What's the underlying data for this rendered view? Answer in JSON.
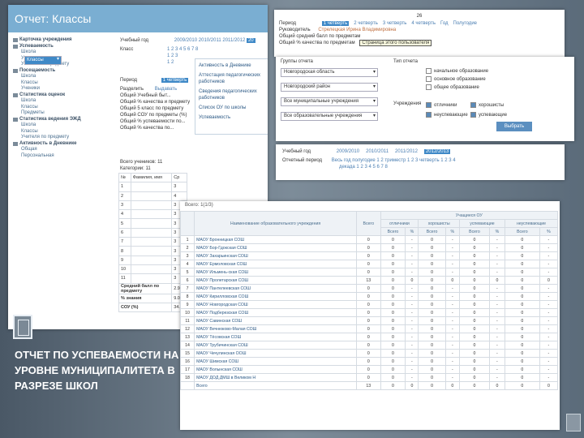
{
  "slide": {
    "caption": "ОТЧЕТ ПО УСПЕВАЕМОСТИ НА УРОВНЕ МУНИЦИПАЛИТЕТА В РАЗРЕЗЕ ШКОЛ"
  },
  "shot1": {
    "title": "Отчет: Классы",
    "sidebar": [
      {
        "type": "g",
        "label": "Карточка учреждения"
      },
      {
        "type": "g",
        "label": "Успеваемость"
      },
      {
        "type": "i",
        "label": "Школа"
      },
      {
        "type": "i",
        "label": "Классы",
        "selected": true
      },
      {
        "type": "i",
        "label": "Ученики"
      },
      {
        "type": "i",
        "label": "Ученики по предмету"
      },
      {
        "type": "g",
        "label": "Посещаемость"
      },
      {
        "type": "i",
        "label": "Школа"
      },
      {
        "type": "i",
        "label": "Классы"
      },
      {
        "type": "i",
        "label": "Ученики"
      },
      {
        "type": "g",
        "label": "Статистика оценок"
      },
      {
        "type": "i",
        "label": "Школа"
      },
      {
        "type": "i",
        "label": "Классы"
      },
      {
        "type": "i",
        "label": "Предметы"
      },
      {
        "type": "g",
        "label": "Статистика ведения ЭЖД"
      },
      {
        "type": "i",
        "label": "Школа"
      },
      {
        "type": "i",
        "label": "Классы"
      },
      {
        "type": "i",
        "label": "Учителя по предмету"
      },
      {
        "type": "g",
        "label": "Активность в Дневнике"
      },
      {
        "type": "i",
        "label": "Общая"
      },
      {
        "type": "i",
        "label": "Персональная"
      }
    ],
    "years_label": "Учебный год",
    "years": [
      "2009/2010",
      "2010/2011",
      "2011/2012",
      "20"
    ],
    "class_label": "Класс",
    "class_nums": "1 2 3 4 5 6 7 8",
    "class_nums2": "1 2 3",
    "class_nums3": "1 2",
    "period_label": "Период",
    "period_value": "1 четверть",
    "razdel_label": "Разделить",
    "razdel_value": "Выдавать",
    "rows": [
      "Общий Учебный быт...",
      "Общий % качества и предмету",
      "Общий 5 класс по предмету",
      "Общий СОУ по предметы (%)",
      "Общий % успеваемости по...",
      "Общий % качества по..."
    ],
    "popup": [
      "Активность в Дневнике",
      "Аттестация педагогических работников",
      "Сведения педагогических работников",
      "Список ОУ по школы",
      "Успеваемость"
    ],
    "count_note": "Всего учеников: 11",
    "count_note2": "Категории: 11",
    "tbl_headers": [
      "№",
      "Фамилия, имя",
      "Ср"
    ],
    "tbl_rows": [
      [
        "1",
        "",
        "3"
      ],
      [
        "2",
        "",
        "4"
      ],
      [
        "3",
        "",
        "3"
      ],
      [
        "4",
        "",
        "3"
      ],
      [
        "5",
        "",
        "3"
      ],
      [
        "6",
        "",
        "3"
      ],
      [
        "7",
        "",
        "3"
      ],
      [
        "8",
        "",
        "3"
      ],
      [
        "9",
        "",
        "3"
      ],
      [
        "10",
        "",
        "3"
      ],
      [
        "11",
        "",
        "3"
      ]
    ],
    "tbl_foot": [
      [
        "Средний балл по предмету",
        "2.91"
      ],
      [
        "% знания",
        "9.09"
      ],
      [
        "СОУ (%)",
        "34.91"
      ]
    ]
  },
  "shot2": {
    "top_num": "26",
    "period_label": "Период",
    "periods": [
      "1 четверть",
      "2 четверть",
      "3 четверть",
      "4 четверть",
      "Год",
      "Полугодие"
    ],
    "lbl1": "Руководитель",
    "val1": "Стрелецкая Ирина Владимировна",
    "line1": "Общий средний балл по предметам",
    "line2": "Общий % качества по предметам",
    "tip": "Страница этого пользователя"
  },
  "shot3": {
    "rows_label": "Группы отчета",
    "selects": [
      "Новгородская область",
      "Новгородский район",
      "Все муниципальные учреждения",
      "Все образовательные учреждения"
    ],
    "type_label": "Тип отчета",
    "org_label": "Учреждения",
    "checks": [
      {
        "label": "начальное образование",
        "on": false
      },
      {
        "label": "основное образование",
        "on": false
      },
      {
        "label": "общее образование",
        "on": false
      },
      {
        "label": "отличники",
        "on": true
      },
      {
        "label": "хорошисты",
        "on": true
      },
      {
        "label": "неуспевающие",
        "on": true
      },
      {
        "label": "успевающие",
        "on": true
      }
    ],
    "button": "Выбрать"
  },
  "shot4": {
    "year_label": "Учебный год",
    "years": [
      "2009/2010",
      "2010/2011",
      "2011/2012",
      "2012/2013"
    ],
    "period_label": "Отчетный период",
    "period_row1": "Весь год   полугодие  1   2   триместр  1   2   3   четверть  1   2   3   4",
    "period_row2": "декада  1   2   3   4   5   6   7   8"
  },
  "shot5": {
    "title": "Всего: 1(1/3)",
    "col_name": "Наименование образовательного учреждения",
    "col_total": "Всего",
    "col_group": "Учащиеся ОУ",
    "sub": [
      "отличники",
      "хорошисты",
      "успевающие",
      "неуспевающие"
    ],
    "sub2": [
      "Всего",
      "%",
      "Всего",
      "%",
      "Всего",
      "%",
      "Всего",
      "%"
    ],
    "rows": [
      [
        "1",
        "МАОУ Бронницкая СОШ",
        "0",
        "0",
        "-",
        "0",
        "-",
        "0",
        "-",
        "0",
        "-"
      ],
      [
        "2",
        "МАОУ Бор-Гдокская СОШ",
        "0",
        "0",
        "-",
        "0",
        "-",
        "0",
        "-",
        "0",
        "-"
      ],
      [
        "3",
        "МАОУ Захарьинская СОШ",
        "0",
        "0",
        "-",
        "0",
        "-",
        "0",
        "-",
        "0",
        "-"
      ],
      [
        "4",
        "МАОУ Ермоловская СОШ",
        "0",
        "0",
        "-",
        "0",
        "-",
        "0",
        "-",
        "0",
        "-"
      ],
      [
        "5",
        "МАОУ Ильмень-ская СОШ",
        "0",
        "0",
        "-",
        "0",
        "-",
        "0",
        "-",
        "0",
        "-"
      ],
      [
        "6",
        "МАОУ Пролетарская СОШ",
        "13",
        "0",
        "0",
        "0",
        "0",
        "0",
        "0",
        "0",
        "0"
      ],
      [
        "7",
        "МАОУ Пантелеевская СОШ",
        "0",
        "0",
        "-",
        "0",
        "-",
        "0",
        "-",
        "0",
        "-"
      ],
      [
        "8",
        "МАОУ Кирилловская СОШ",
        "0",
        "0",
        "-",
        "0",
        "-",
        "0",
        "-",
        "0",
        "-"
      ],
      [
        "9",
        "МАОУ Новгородская СОШ",
        "0",
        "0",
        "-",
        "0",
        "-",
        "0",
        "-",
        "0",
        "-"
      ],
      [
        "10",
        "МАОУ Подберезская СОШ",
        "0",
        "0",
        "-",
        "0",
        "-",
        "0",
        "-",
        "0",
        "-"
      ],
      [
        "11",
        "МАОУ Савинская СОШ",
        "0",
        "0",
        "-",
        "0",
        "-",
        "0",
        "-",
        "0",
        "-"
      ],
      [
        "12",
        "МАОУ Вечнюково-Малая СОШ",
        "0",
        "0",
        "-",
        "0",
        "-",
        "0",
        "-",
        "0",
        "-"
      ],
      [
        "13",
        "МАОУ Тёсовская СОШ",
        "0",
        "0",
        "-",
        "0",
        "-",
        "0",
        "-",
        "0",
        "-"
      ],
      [
        "14",
        "МАОУ Трубичинская СОШ",
        "0",
        "0",
        "-",
        "0",
        "-",
        "0",
        "-",
        "0",
        "-"
      ],
      [
        "15",
        "МАОУ Чечулинская ООШ",
        "0",
        "0",
        "-",
        "0",
        "-",
        "0",
        "-",
        "0",
        "-"
      ],
      [
        "16",
        "МАОУ Шимская СОШ",
        "0",
        "0",
        "-",
        "0",
        "-",
        "0",
        "-",
        "0",
        "-"
      ],
      [
        "17",
        "МАОУ Волынская СОШ",
        "0",
        "0",
        "-",
        "0",
        "-",
        "0",
        "-",
        "0",
        "-"
      ],
      [
        "18",
        "МАОУ ДОД ДМШ в Великом Н",
        "0",
        "0",
        "-",
        "0",
        "-",
        "0",
        "-",
        "0",
        "-"
      ]
    ],
    "foot": [
      "",
      "Всего",
      "13",
      "0",
      "0",
      "0",
      "0",
      "0",
      "0",
      "0",
      "0"
    ]
  }
}
